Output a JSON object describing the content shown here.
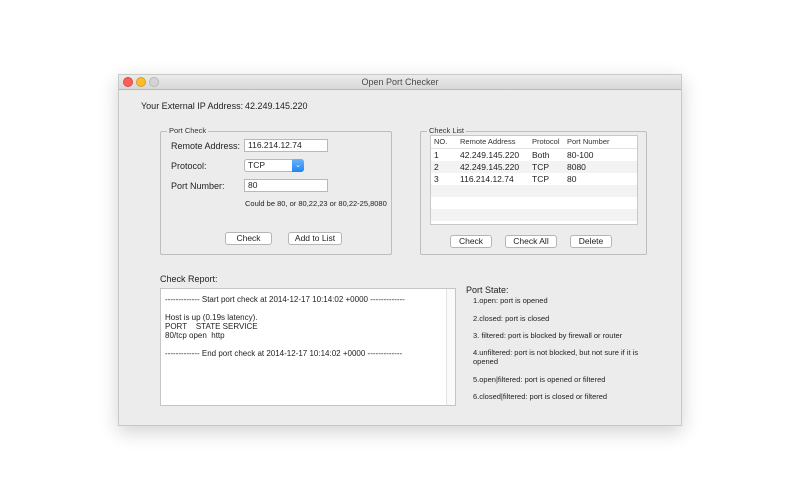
{
  "window": {
    "title": "Open Port Checker"
  },
  "ip": {
    "label": "Your External IP Address:",
    "value": "42.249.145.220"
  },
  "port_check": {
    "title": "Port Check",
    "remote_label": "Remote Address:",
    "remote_value": "116.214.12.74",
    "protocol_label": "Protocol:",
    "protocol_value": "TCP",
    "port_label": "Port Number:",
    "port_value": "80",
    "hint": "Could be 80, or 80,22,23 or 80,22-25,8080",
    "check_label": "Check",
    "add_label": "Add to List"
  },
  "check_list": {
    "title": "Check List",
    "headers": [
      "NO.",
      "Remote Address",
      "Protocol",
      "Port Number"
    ],
    "rows": [
      [
        "1",
        "42.249.145.220",
        "Both",
        "80-100"
      ],
      [
        "2",
        "42.249.145.220",
        "TCP",
        "8080"
      ],
      [
        "3",
        "116.214.12.74",
        "TCP",
        "80"
      ]
    ],
    "check_label": "Check",
    "check_all_label": "Check All",
    "delete_label": "Delete"
  },
  "report": {
    "label": "Check Report:",
    "lines": [
      "------------- Start port check at 2014-12-17 10:14:02 +0000 -------------",
      "",
      "Host is up (0.19s latency).",
      "PORT    STATE SERVICE",
      "80/tcp open  http",
      "",
      "------------- End port check at 2014-12-17 10:14:02 +0000 -------------"
    ]
  },
  "port_state": {
    "title": "Port State:",
    "items": [
      "1.open: port is opened",
      "2.closed: port is closed",
      "3. filtered: port is blocked by firewall or router",
      "4.unfiltered: port is not blocked, but not sure if it is",
      "opened",
      "5.open|filtered: port is opened or filtered",
      "6.closed|filtered: port is closed or filtered"
    ]
  }
}
